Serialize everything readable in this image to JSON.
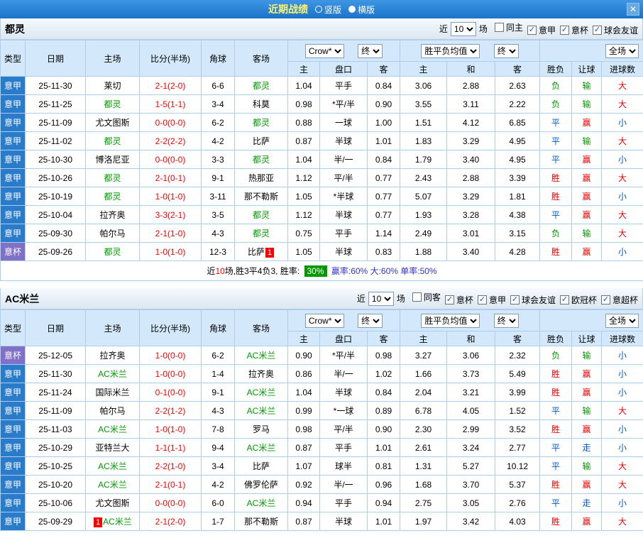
{
  "title_bar": {
    "title": "近期战绩",
    "modes": [
      {
        "label": "竖版",
        "selected": false
      },
      {
        "label": "横版",
        "selected": true
      }
    ],
    "close": "✕"
  },
  "filters_labels": {
    "near": "近",
    "games": "场"
  },
  "table_header": {
    "type": "类型",
    "date": "日期",
    "home": "主场",
    "score": "比分(半场)",
    "corner": "角球",
    "away": "客场",
    "odds_source": "Crow*",
    "final": "终",
    "avg": "胜平负均值",
    "scope": "全场",
    "sub": [
      "主",
      "盘口",
      "客",
      "主",
      "和",
      "客",
      "胜负",
      "让球",
      "进球数"
    ]
  },
  "colors": {
    "titlebar_blue": "#1c73c9",
    "league_badge": "#2a7ccb",
    "cup_badge": "#7f71c6",
    "focus_team_green": "#009900",
    "score_red": "#ff0000",
    "win_red": "#e60000",
    "draw_blue": "#0059cc",
    "loss_green": "#009900",
    "rate_badge_green": "#009900"
  },
  "sections": [
    {
      "team": "都灵",
      "filters": {
        "count": "10",
        "checkboxes": [
          {
            "label": "同主",
            "checked": false
          },
          {
            "label": "意甲",
            "checked": true
          },
          {
            "label": "意杯",
            "checked": true
          },
          {
            "label": "球会友谊",
            "checked": true
          }
        ]
      },
      "rows": [
        {
          "type": "意甲",
          "cup": false,
          "date": "25-11-30",
          "home": "莱切",
          "home_focus": false,
          "score": "2-1(2-0)",
          "corner": "6-6",
          "away": "都灵",
          "away_focus": true,
          "odds": [
            "1.04",
            "平手",
            "0.84",
            "3.06",
            "2.88",
            "2.63"
          ],
          "results": [
            {
              "t": "负",
              "c": "green"
            },
            {
              "t": "输",
              "c": "green"
            },
            {
              "t": "大",
              "c": "red"
            }
          ]
        },
        {
          "type": "意甲",
          "cup": false,
          "date": "25-11-25",
          "home": "都灵",
          "home_focus": true,
          "score": "1-5(1-1)",
          "corner": "3-4",
          "away": "科莫",
          "away_focus": false,
          "odds": [
            "0.98",
            "*平/半",
            "0.90",
            "3.55",
            "3.11",
            "2.22"
          ],
          "results": [
            {
              "t": "负",
              "c": "green"
            },
            {
              "t": "输",
              "c": "green"
            },
            {
              "t": "大",
              "c": "red"
            }
          ]
        },
        {
          "type": "意甲",
          "cup": false,
          "date": "25-11-09",
          "home": "尤文图斯",
          "home_focus": false,
          "score": "0-0(0-0)",
          "corner": "6-2",
          "away": "都灵",
          "away_focus": true,
          "odds": [
            "0.88",
            "一球",
            "1.00",
            "1.51",
            "4.12",
            "6.85"
          ],
          "results": [
            {
              "t": "平",
              "c": "blue"
            },
            {
              "t": "赢",
              "c": "red"
            },
            {
              "t": "小",
              "c": "blue"
            }
          ]
        },
        {
          "type": "意甲",
          "cup": false,
          "date": "25-11-02",
          "home": "都灵",
          "home_focus": true,
          "score": "2-2(2-2)",
          "corner": "4-2",
          "away": "比萨",
          "away_focus": false,
          "odds": [
            "0.87",
            "半球",
            "1.01",
            "1.83",
            "3.29",
            "4.95"
          ],
          "results": [
            {
              "t": "平",
              "c": "blue"
            },
            {
              "t": "输",
              "c": "green"
            },
            {
              "t": "大",
              "c": "red"
            }
          ]
        },
        {
          "type": "意甲",
          "cup": false,
          "date": "25-10-30",
          "home": "博洛尼亚",
          "home_focus": false,
          "score": "0-0(0-0)",
          "corner": "3-3",
          "away": "都灵",
          "away_focus": true,
          "odds": [
            "1.04",
            "半/一",
            "0.84",
            "1.79",
            "3.40",
            "4.95"
          ],
          "results": [
            {
              "t": "平",
              "c": "blue"
            },
            {
              "t": "赢",
              "c": "red"
            },
            {
              "t": "小",
              "c": "blue"
            }
          ]
        },
        {
          "type": "意甲",
          "cup": false,
          "date": "25-10-26",
          "home": "都灵",
          "home_focus": true,
          "score": "2-1(0-1)",
          "corner": "9-1",
          "away": "热那亚",
          "away_focus": false,
          "odds": [
            "1.12",
            "平/半",
            "0.77",
            "2.43",
            "2.88",
            "3.39"
          ],
          "results": [
            {
              "t": "胜",
              "c": "red"
            },
            {
              "t": "赢",
              "c": "red"
            },
            {
              "t": "大",
              "c": "red"
            }
          ]
        },
        {
          "type": "意甲",
          "cup": false,
          "date": "25-10-19",
          "home": "都灵",
          "home_focus": true,
          "score": "1-0(1-0)",
          "corner": "3-11",
          "away": "那不勒斯",
          "away_focus": false,
          "odds": [
            "1.05",
            "*半球",
            "0.77",
            "5.07",
            "3.29",
            "1.81"
          ],
          "results": [
            {
              "t": "胜",
              "c": "red"
            },
            {
              "t": "赢",
              "c": "red"
            },
            {
              "t": "小",
              "c": "blue"
            }
          ]
        },
        {
          "type": "意甲",
          "cup": false,
          "date": "25-10-04",
          "home": "拉齐奥",
          "home_focus": false,
          "score": "3-3(2-1)",
          "corner": "3-5",
          "away": "都灵",
          "away_focus": true,
          "odds": [
            "1.12",
            "半球",
            "0.77",
            "1.93",
            "3.28",
            "4.38"
          ],
          "results": [
            {
              "t": "平",
              "c": "blue"
            },
            {
              "t": "赢",
              "c": "red"
            },
            {
              "t": "大",
              "c": "red"
            }
          ]
        },
        {
          "type": "意甲",
          "cup": false,
          "date": "25-09-30",
          "home": "帕尔马",
          "home_focus": false,
          "score": "2-1(1-0)",
          "corner": "4-3",
          "away": "都灵",
          "away_focus": true,
          "odds": [
            "0.75",
            "平手",
            "1.14",
            "2.49",
            "3.01",
            "3.15"
          ],
          "results": [
            {
              "t": "负",
              "c": "green"
            },
            {
              "t": "输",
              "c": "green"
            },
            {
              "t": "大",
              "c": "red"
            }
          ]
        },
        {
          "type": "意杯",
          "cup": true,
          "date": "25-09-26",
          "home": "都灵",
          "home_focus": true,
          "score": "1-0(1-0)",
          "corner": "12-3",
          "away": "比萨",
          "away_focus": false,
          "away_badge": "1",
          "away_badge_pos": "after",
          "odds": [
            "1.05",
            "半球",
            "0.83",
            "1.88",
            "3.40",
            "4.28"
          ],
          "results": [
            {
              "t": "胜",
              "c": "red"
            },
            {
              "t": "赢",
              "c": "red"
            },
            {
              "t": "小",
              "c": "blue"
            }
          ]
        }
      ],
      "summary_parts": [
        {
          "text": "近"
        },
        {
          "text": "10",
          "color": "#ff0000"
        },
        {
          "text": "场,胜3平4负3, 胜率: "
        },
        {
          "text": "30%",
          "color": "#ffffff",
          "bg": "#009900"
        },
        {
          "text": " 赢率:60% ",
          "color": "#3333cc"
        },
        {
          "text": " 大:60% ",
          "color": "#3333cc"
        },
        {
          "text": " 单率:50%",
          "color": "#3333cc"
        }
      ]
    },
    {
      "team": "AC米兰",
      "filters": {
        "count": "10",
        "checkboxes": [
          {
            "label": "同客",
            "checked": false
          },
          {
            "label": "意杯",
            "checked": true
          },
          {
            "label": "意甲",
            "checked": true
          },
          {
            "label": "球会友谊",
            "checked": true
          },
          {
            "label": "欧冠杯",
            "checked": true
          },
          {
            "label": "意超杯",
            "checked": true
          }
        ]
      },
      "rows": [
        {
          "type": "意杯",
          "cup": true,
          "date": "25-12-05",
          "home": "拉齐奥",
          "home_focus": false,
          "score": "1-0(0-0)",
          "corner": "6-2",
          "away": "AC米兰",
          "away_focus": true,
          "odds": [
            "0.90",
            "*平/半",
            "0.98",
            "3.27",
            "3.06",
            "2.32"
          ],
          "results": [
            {
              "t": "负",
              "c": "green"
            },
            {
              "t": "输",
              "c": "green"
            },
            {
              "t": "小",
              "c": "blue"
            }
          ]
        },
        {
          "type": "意甲",
          "cup": false,
          "date": "25-11-30",
          "home": "AC米兰",
          "home_focus": true,
          "score": "1-0(0-0)",
          "corner": "1-4",
          "away": "拉齐奥",
          "away_focus": false,
          "odds": [
            "0.86",
            "半/一",
            "1.02",
            "1.66",
            "3.73",
            "5.49"
          ],
          "results": [
            {
              "t": "胜",
              "c": "red"
            },
            {
              "t": "赢",
              "c": "red"
            },
            {
              "t": "小",
              "c": "blue"
            }
          ]
        },
        {
          "type": "意甲",
          "cup": false,
          "date": "25-11-24",
          "home": "国际米兰",
          "home_focus": false,
          "score": "0-1(0-0)",
          "corner": "9-1",
          "away": "AC米兰",
          "away_focus": true,
          "odds": [
            "1.04",
            "半球",
            "0.84",
            "2.04",
            "3.21",
            "3.99"
          ],
          "results": [
            {
              "t": "胜",
              "c": "red"
            },
            {
              "t": "赢",
              "c": "red"
            },
            {
              "t": "小",
              "c": "blue"
            }
          ]
        },
        {
          "type": "意甲",
          "cup": false,
          "date": "25-11-09",
          "home": "帕尔马",
          "home_focus": false,
          "score": "2-2(1-2)",
          "corner": "4-3",
          "away": "AC米兰",
          "away_focus": true,
          "odds": [
            "0.99",
            "*一球",
            "0.89",
            "6.78",
            "4.05",
            "1.52"
          ],
          "results": [
            {
              "t": "平",
              "c": "blue"
            },
            {
              "t": "输",
              "c": "green"
            },
            {
              "t": "大",
              "c": "red"
            }
          ]
        },
        {
          "type": "意甲",
          "cup": false,
          "date": "25-11-03",
          "home": "AC米兰",
          "home_focus": true,
          "score": "1-0(1-0)",
          "corner": "7-8",
          "away": "罗马",
          "away_focus": false,
          "odds": [
            "0.98",
            "平/半",
            "0.90",
            "2.30",
            "2.99",
            "3.52"
          ],
          "results": [
            {
              "t": "胜",
              "c": "red"
            },
            {
              "t": "赢",
              "c": "red"
            },
            {
              "t": "小",
              "c": "blue"
            }
          ]
        },
        {
          "type": "意甲",
          "cup": false,
          "date": "25-10-29",
          "home": "亚特兰大",
          "home_focus": false,
          "score": "1-1(1-1)",
          "corner": "9-4",
          "away": "AC米兰",
          "away_focus": true,
          "odds": [
            "0.87",
            "平手",
            "1.01",
            "2.61",
            "3.24",
            "2.77"
          ],
          "results": [
            {
              "t": "平",
              "c": "blue"
            },
            {
              "t": "走",
              "c": "blue"
            },
            {
              "t": "小",
              "c": "blue"
            }
          ]
        },
        {
          "type": "意甲",
          "cup": false,
          "date": "25-10-25",
          "home": "AC米兰",
          "home_focus": true,
          "score": "2-2(1-0)",
          "corner": "3-4",
          "away": "比萨",
          "away_focus": false,
          "odds": [
            "1.07",
            "球半",
            "0.81",
            "1.31",
            "5.27",
            "10.12"
          ],
          "results": [
            {
              "t": "平",
              "c": "blue"
            },
            {
              "t": "输",
              "c": "green"
            },
            {
              "t": "大",
              "c": "red"
            }
          ]
        },
        {
          "type": "意甲",
          "cup": false,
          "date": "25-10-20",
          "home": "AC米兰",
          "home_focus": true,
          "score": "2-1(0-1)",
          "corner": "4-2",
          "away": "佛罗伦萨",
          "away_focus": false,
          "odds": [
            "0.92",
            "半/一",
            "0.96",
            "1.68",
            "3.70",
            "5.37"
          ],
          "results": [
            {
              "t": "胜",
              "c": "red"
            },
            {
              "t": "赢",
              "c": "red"
            },
            {
              "t": "大",
              "c": "red"
            }
          ]
        },
        {
          "type": "意甲",
          "cup": false,
          "date": "25-10-06",
          "home": "尤文图斯",
          "home_focus": false,
          "score": "0-0(0-0)",
          "corner": "6-0",
          "away": "AC米兰",
          "away_focus": true,
          "odds": [
            "0.94",
            "平手",
            "0.94",
            "2.75",
            "3.05",
            "2.76"
          ],
          "results": [
            {
              "t": "平",
              "c": "blue"
            },
            {
              "t": "走",
              "c": "blue"
            },
            {
              "t": "小",
              "c": "blue"
            }
          ]
        },
        {
          "type": "意甲",
          "cup": false,
          "date": "25-09-29",
          "home": "AC米兰",
          "home_focus": true,
          "home_badge": "1",
          "home_badge_pos": "before",
          "score": "2-1(2-0)",
          "corner": "1-7",
          "away": "那不勒斯",
          "away_focus": false,
          "odds": [
            "0.87",
            "半球",
            "1.01",
            "1.97",
            "3.42",
            "4.03"
          ],
          "results": [
            {
              "t": "胜",
              "c": "red"
            },
            {
              "t": "赢",
              "c": "red"
            },
            {
              "t": "大",
              "c": "red"
            }
          ]
        }
      ],
      "summary_parts": null
    }
  ]
}
